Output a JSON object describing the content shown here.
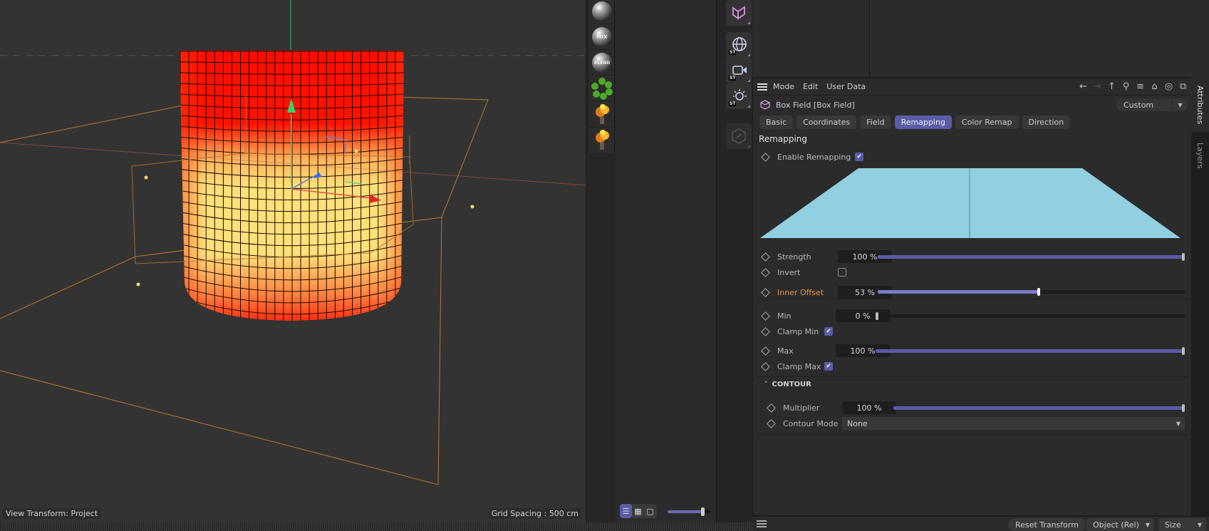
{
  "viewport": {
    "view_transform_label": "View Transform: Project",
    "grid_spacing_label": "Grid Spacing : 500 cm"
  },
  "material_strip": {
    "items": [
      {
        "name": "material",
        "label": ""
      },
      {
        "name": "mix",
        "label": "MIX"
      },
      {
        "name": "blend",
        "label": "BLEND"
      },
      {
        "name": "vegetation-green",
        "label": ""
      },
      {
        "name": "explosion",
        "label": ""
      },
      {
        "name": "explosion",
        "label": ""
      }
    ]
  },
  "tool_column": {
    "items": [
      {
        "name": "spline-tool",
        "badge": ""
      },
      {
        "name": "globe-st",
        "badge": "ST"
      },
      {
        "name": "camera-st",
        "badge": "ST"
      },
      {
        "name": "light-st",
        "badge": "ST"
      },
      {
        "name": "edit-disabled",
        "badge": ""
      }
    ]
  },
  "attributes": {
    "menu": [
      "Mode",
      "Edit",
      "User Data"
    ],
    "object_name": "Box Field [Box Field]",
    "preset": "Custom",
    "tabs": [
      {
        "label": "Basic",
        "active": false
      },
      {
        "label": "Coordinates",
        "active": false
      },
      {
        "label": "Field",
        "active": false
      },
      {
        "label": "Remapping",
        "active": true
      },
      {
        "label": "Color Remap",
        "active": false
      },
      {
        "label": "Direction",
        "active": false
      }
    ],
    "section_title": "Remapping",
    "enable_remapping": {
      "label": "Enable Remapping",
      "checked": true
    },
    "curve_color": "#92cfe0",
    "strength": {
      "label": "Strength",
      "value": "100 %",
      "fraction": 1.0
    },
    "invert": {
      "label": "Invert",
      "checked": false
    },
    "inner_offset": {
      "label": "Inner Offset",
      "value": "53 %",
      "fraction": 0.53
    },
    "min": {
      "label": "Min",
      "value": "0 %",
      "fraction": 0.0
    },
    "clamp_min": {
      "label": "Clamp Min",
      "checked": true
    },
    "max": {
      "label": "Max",
      "value": "100 %",
      "fraction": 1.0
    },
    "clamp_max": {
      "label": "Clamp Max",
      "checked": true
    },
    "contour": {
      "title": "CONTOUR",
      "multiplier": {
        "label": "Multiplier",
        "value": "100 %",
        "fraction": 1.0
      },
      "mode": {
        "label": "Contour Mode",
        "value": "None"
      }
    },
    "bottom": {
      "reset_transform": "Reset Transform",
      "coord_mode": "Object (Rel)",
      "transform_type": "Size"
    }
  },
  "side_tabs": [
    "Attributes",
    "Layers"
  ],
  "colors": {
    "accent": "#5a5ca8",
    "animated_label": "#e8924a",
    "cylinder_hot": "#ff1a00",
    "cylinder_warm": "#ffe27a",
    "field_box": "#d9913a"
  }
}
